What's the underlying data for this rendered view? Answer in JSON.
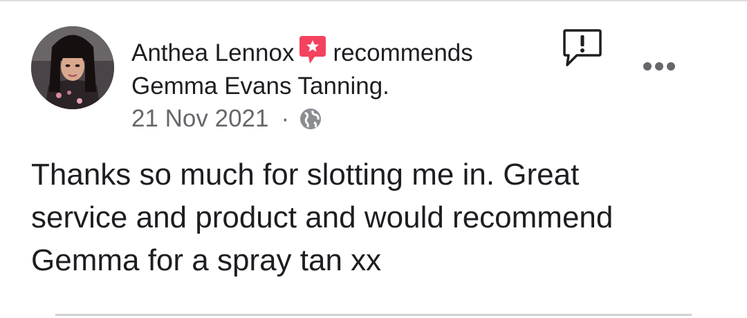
{
  "post": {
    "author_name": "Anthea Lennox",
    "action_text": "recommends",
    "page_name": "Gemma Evans Tanning.",
    "date": "21 Nov 2021",
    "separator": "·",
    "privacy_icon": "globe-icon",
    "recommend_icon": "recommend-badge-icon",
    "report_icon": "report-icon",
    "more_icon": "more-options-icon",
    "body": "Thanks so much for slotting me in.  Great\nservice and product and would recommend\nGemma for a spray tan xx"
  },
  "colors": {
    "text_primary": "#1c1e21",
    "text_secondary": "#65676b",
    "recommend_badge": "#f3425f",
    "divider": "#ced0d4"
  }
}
